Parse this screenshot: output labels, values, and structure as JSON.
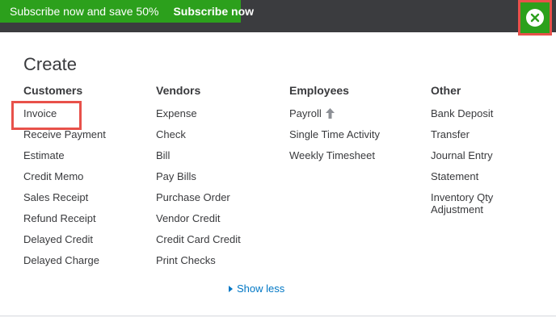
{
  "promo": {
    "text": "Subscribe now and save 50%",
    "cta_label": "Subscribe now"
  },
  "title": "Create",
  "columns": [
    {
      "heading": "Customers",
      "items": [
        "Invoice",
        "Receive Payment",
        "Estimate",
        "Credit Memo",
        "Sales Receipt",
        "Refund Receipt",
        "Delayed Credit",
        "Delayed Charge"
      ]
    },
    {
      "heading": "Vendors",
      "items": [
        "Expense",
        "Check",
        "Bill",
        "Pay Bills",
        "Purchase Order",
        "Vendor Credit",
        "Credit Card Credit",
        "Print Checks"
      ]
    },
    {
      "heading": "Employees",
      "items": [
        "Payroll",
        "Single Time Activity",
        "Weekly Timesheet"
      ]
    },
    {
      "heading": "Other",
      "items": [
        "Bank Deposit",
        "Transfer",
        "Journal Entry",
        "Statement",
        "Inventory Qty Adjustment"
      ]
    }
  ],
  "show_less_label": "Show less",
  "colors": {
    "brand_green": "#2ca01c",
    "topbar": "#3b3c3f",
    "link_blue": "#0077c5",
    "highlight_red": "#e8514a"
  },
  "icons": {
    "close": "close-icon",
    "payroll_badge": "arrow-up-icon",
    "show_less": "caret-right-icon"
  }
}
